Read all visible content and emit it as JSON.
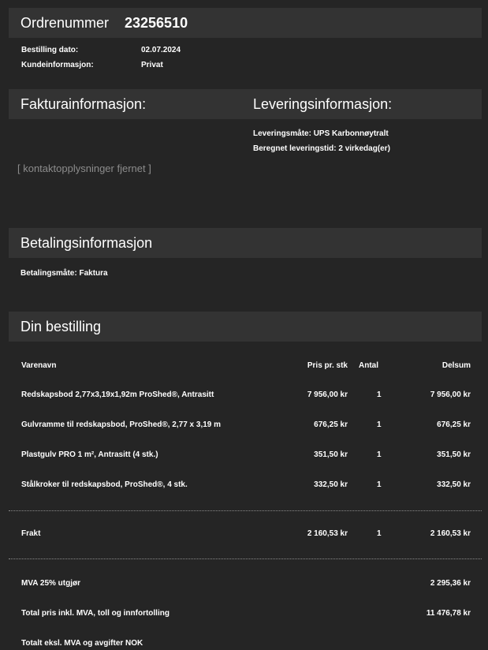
{
  "order": {
    "label": "Ordrenummer",
    "number": "23256510"
  },
  "order_info": [
    {
      "label": "Bestilling dato:",
      "value": "02.07.2024"
    },
    {
      "label": "Kundeinformasjon:",
      "value": "Privat"
    }
  ],
  "invoice": {
    "title": "Fakturainformasjon:",
    "redacted": "[ kontaktopplysninger fjernet ]"
  },
  "delivery": {
    "title": "Leveringsinformasjon:",
    "method": "Leveringsmåte: UPS Karbonnøytralt",
    "time": "Beregnet leveringstid: 2 virkedag(er)"
  },
  "payment": {
    "title": "Betalingsinformasjon",
    "method": "Betalingsmåte: Faktura"
  },
  "cart": {
    "title": "Din bestilling",
    "headers": {
      "name": "Varenavn",
      "price": "Pris pr. stk",
      "qty": "Antal",
      "subtotal": "Delsum"
    },
    "items": [
      {
        "name": "Redskapsbod 2,77x3,19x1,92m ProShed®, Antrasitt",
        "price": "7 956,00 kr",
        "qty": "1",
        "subtotal": "7 956,00 kr"
      },
      {
        "name": "Gulvramme til redskapsbod, ProShed®, 2,77 x 3,19 m",
        "price": "676,25 kr",
        "qty": "1",
        "subtotal": "676,25 kr"
      },
      {
        "name": "Plastgulv PRO 1 m², Antrasitt (4 stk.)",
        "price": "351,50 kr",
        "qty": "1",
        "subtotal": "351,50 kr"
      },
      {
        "name": "Stålkroker til redskapsbod, ProShed®, 4 stk.",
        "price": "332,50 kr",
        "qty": "1",
        "subtotal": "332,50 kr"
      }
    ],
    "freight": {
      "name": "Frakt",
      "price": "2 160,53 kr",
      "qty": "1",
      "subtotal": "2 160,53 kr"
    },
    "totals": [
      {
        "label": "MVA 25% utgjør",
        "value": "2 295,36 kr"
      },
      {
        "label": "Total pris inkl. MVA, toll og innfortolling",
        "value": "11 476,78 kr"
      },
      {
        "label": "Totalt eksl. MVA og avgifter NOK",
        "value": ""
      }
    ]
  }
}
